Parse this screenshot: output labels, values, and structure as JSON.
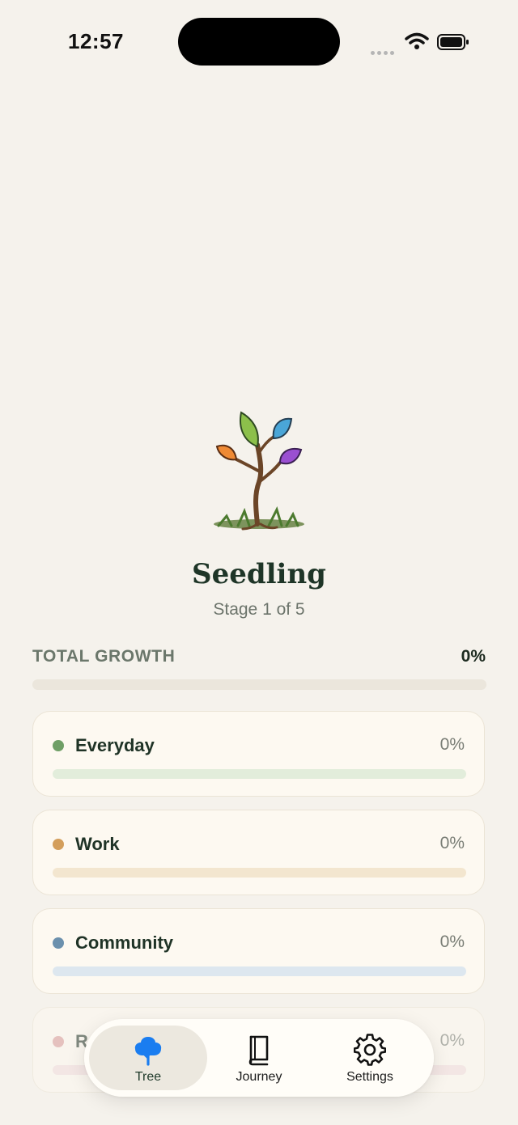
{
  "status_bar": {
    "time": "12:57"
  },
  "tree": {
    "stage_name": "Seedling",
    "stage_label": "Stage 1 of 5"
  },
  "total_growth": {
    "label": "TOTAL GROWTH",
    "value_label": "0%",
    "fraction": 0,
    "color": "#6aa165"
  },
  "categories": [
    {
      "name": "Everyday",
      "value_label": "0%",
      "fraction": 0,
      "dot_color": "#6f9f66",
      "track_color": "#e2eddb"
    },
    {
      "name": "Work",
      "value_label": "0%",
      "fraction": 0,
      "dot_color": "#d39e5b",
      "track_color": "#f3e6cf"
    },
    {
      "name": "Community",
      "value_label": "0%",
      "fraction": 0,
      "dot_color": "#6b90ad",
      "track_color": "#dde7ef"
    },
    {
      "name": "R",
      "value_label": "0%",
      "fraction": 0,
      "dot_color": "#d99a9a",
      "track_color": "#f3dede"
    }
  ],
  "tab_bar": {
    "tabs": [
      {
        "label": "Tree",
        "icon": "tree-icon",
        "active": true,
        "color": "#1a7df0"
      },
      {
        "label": "Journey",
        "icon": "book-icon",
        "active": false
      },
      {
        "label": "Settings",
        "icon": "gear-icon",
        "active": false
      }
    ]
  }
}
